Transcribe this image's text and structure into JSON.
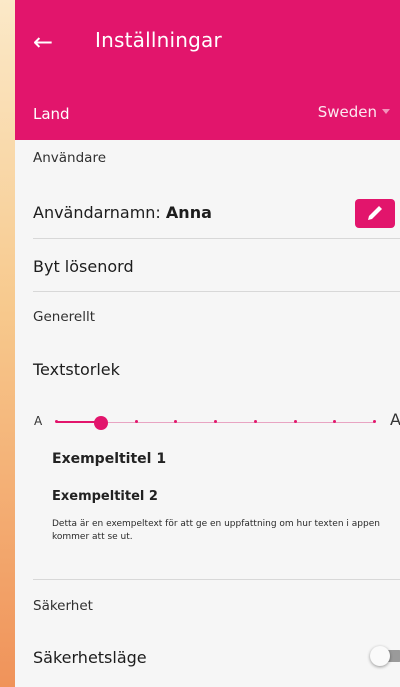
{
  "header": {
    "back_icon": "arrow-left-icon",
    "title": "Inställningar"
  },
  "country": {
    "label": "Land",
    "value": "Sweden"
  },
  "user_section": {
    "heading": "Användare",
    "username_label": "Användarnamn:",
    "username_value": "Anna",
    "edit_icon": "pencil-icon",
    "change_password": "Byt lösenord"
  },
  "general_section": {
    "heading": "Generellt",
    "text_size_label": "Textstorlek",
    "slider": {
      "min_label": "A",
      "max_label": "A",
      "steps": 9,
      "selected_step": 2
    },
    "example_title_1": "Exempeltitel 1",
    "example_title_2": "Exempeltitel 2",
    "example_text": "Detta är en exempeltext för att ge en uppfattning om hur texten i appen kommer att se ut."
  },
  "security_section": {
    "heading": "Säkerhet",
    "safe_mode_label": "Säkerhetsläge",
    "safe_mode_on": false
  },
  "colors": {
    "primary": "#e2156c",
    "background": "#f6f6f6"
  }
}
